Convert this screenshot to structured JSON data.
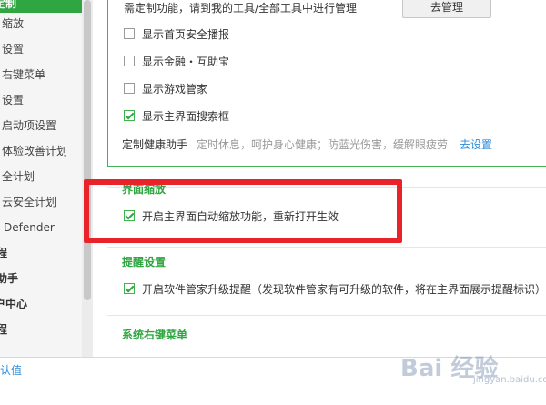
{
  "sidebar": {
    "items": [
      {
        "label": "定制",
        "state": "active"
      },
      {
        "label": "缩放",
        "state": "normal"
      },
      {
        "label": "设置",
        "state": "normal"
      },
      {
        "label": "右键菜单",
        "state": "normal"
      },
      {
        "label": "设置",
        "state": "normal"
      },
      {
        "label": "启动项设置",
        "state": "normal"
      },
      {
        "label": "体验改善计划",
        "state": "normal"
      },
      {
        "label": "全计划",
        "state": "normal"
      },
      {
        "label": "云安全计划",
        "state": "normal"
      },
      {
        "label": "Defender",
        "state": "normal"
      },
      {
        "label": "程",
        "state": "bold"
      },
      {
        "label": "助手",
        "state": "bold"
      },
      {
        "label": "户中心",
        "state": "bold"
      },
      {
        "label": "程",
        "state": "bold"
      }
    ]
  },
  "custom_section": {
    "tip": "需定制功能，请到我的工具/全部工具中进行管理",
    "manage_button": "去管理",
    "options": [
      {
        "label": "显示首页安全播报",
        "checked": false
      },
      {
        "label": "显示金融・互助宝",
        "checked": false
      },
      {
        "label": "显示游戏管家",
        "checked": false
      },
      {
        "label": "显示主界面搜索框",
        "checked": true
      }
    ],
    "health": {
      "label": "定制健康助手",
      "hint": "定时休息，呵护身心健康；防蓝光伤害，缓解眼疲劳",
      "link": "去设置"
    }
  },
  "zoom_section": {
    "title": "界面缩放",
    "option": {
      "label": "开启主界面自动缩放功能，重新打开生效",
      "checked": true
    }
  },
  "reminder_section": {
    "title": "提醒设置",
    "option": {
      "label": "开启软件管家升级提醒（发现软件管家有可升级的软件，将在主界面展示提醒标识）",
      "checked": true
    }
  },
  "context_menu_section": {
    "title": "系统右键菜单"
  },
  "footer": {
    "reset_link": "认值"
  },
  "watermark": {
    "text": "Bai 经验",
    "sub": "jingyan.baidu.com"
  },
  "colors": {
    "accent": "#2fa641",
    "highlight_border": "#e8232a",
    "link": "#2e8bd9"
  }
}
